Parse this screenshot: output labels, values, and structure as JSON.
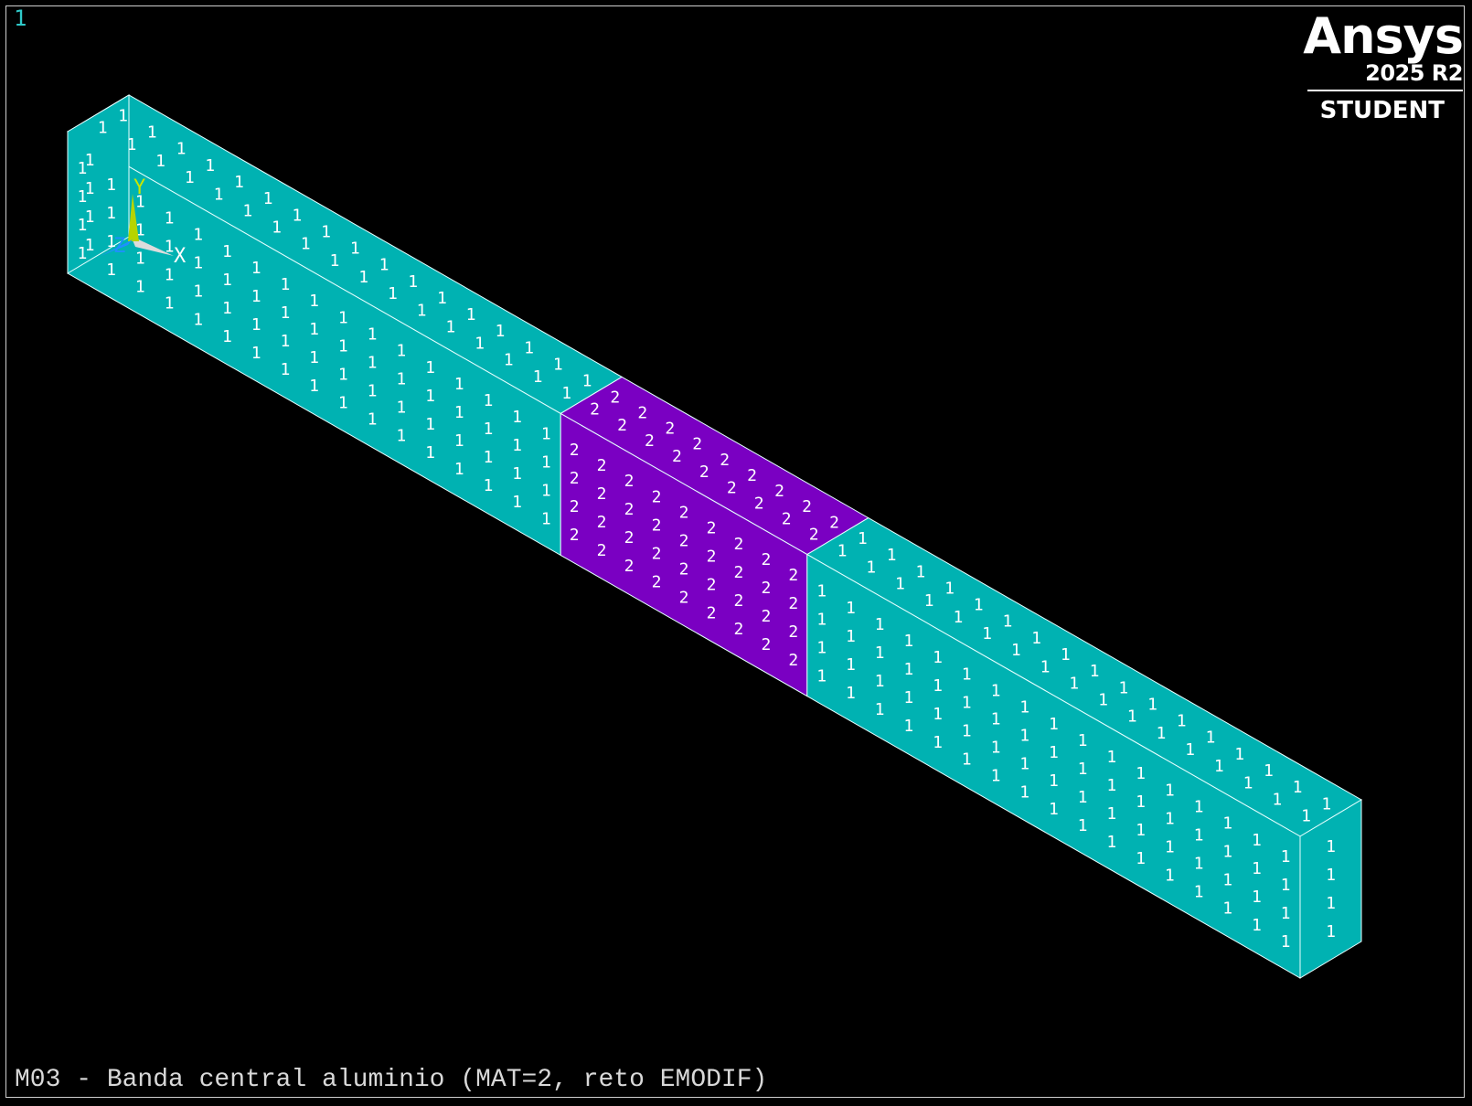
{
  "window": {
    "number": "1",
    "title": "M03 - Banda central aluminio (MAT=2, reto EMODIF)"
  },
  "logo": {
    "name": "Ansys",
    "version": "2025 R2",
    "edition": "STUDENT"
  },
  "triad": {
    "x_label": "X",
    "y_label": "Y",
    "z_label": "Z"
  },
  "model": {
    "materials": [
      {
        "id": "1",
        "color": "#00b2b2"
      },
      {
        "id": "2",
        "color": "#7a00c2"
      }
    ],
    "edge_color": "#e6ffff",
    "segments": [
      {
        "material": "1",
        "from": 0.0,
        "to": 0.4
      },
      {
        "material": "2",
        "from": 0.4,
        "to": 0.6
      },
      {
        "material": "1",
        "from": 0.6,
        "to": 1.0
      }
    ]
  },
  "colors": {
    "background": "#000000",
    "frame": "#cfcfcf",
    "window_number": "#2fc9c9",
    "axis_x": "#ffffff",
    "axis_y": "#c8e600",
    "axis_z": "#1e90ff"
  }
}
